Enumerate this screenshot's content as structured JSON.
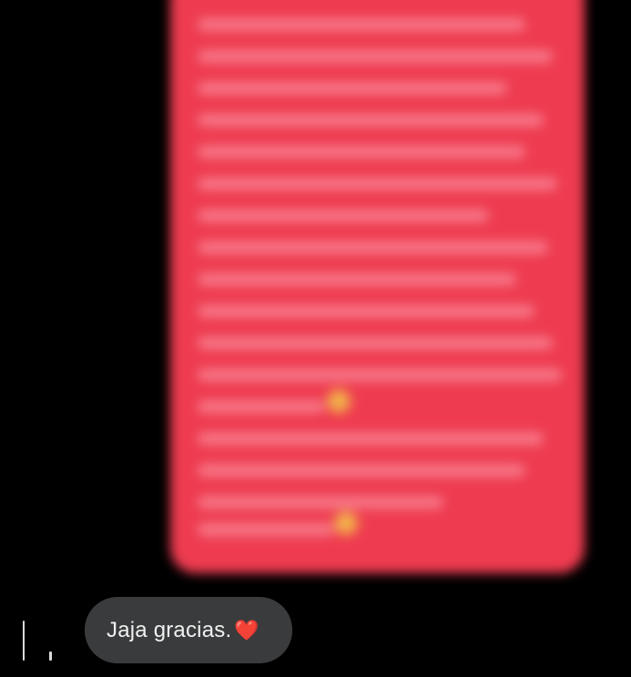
{
  "conversation": {
    "sent_message": {
      "content": "",
      "blurred": true,
      "bubble_color": "#ee3b50"
    },
    "received_message": {
      "text": "Jaja gracias.",
      "emoji": "❤️",
      "emoji_icon": "red-heart-icon",
      "bubble_color": "#3a3b3c"
    }
  },
  "colors": {
    "background": "#000000",
    "text": "#f0f0f0"
  }
}
